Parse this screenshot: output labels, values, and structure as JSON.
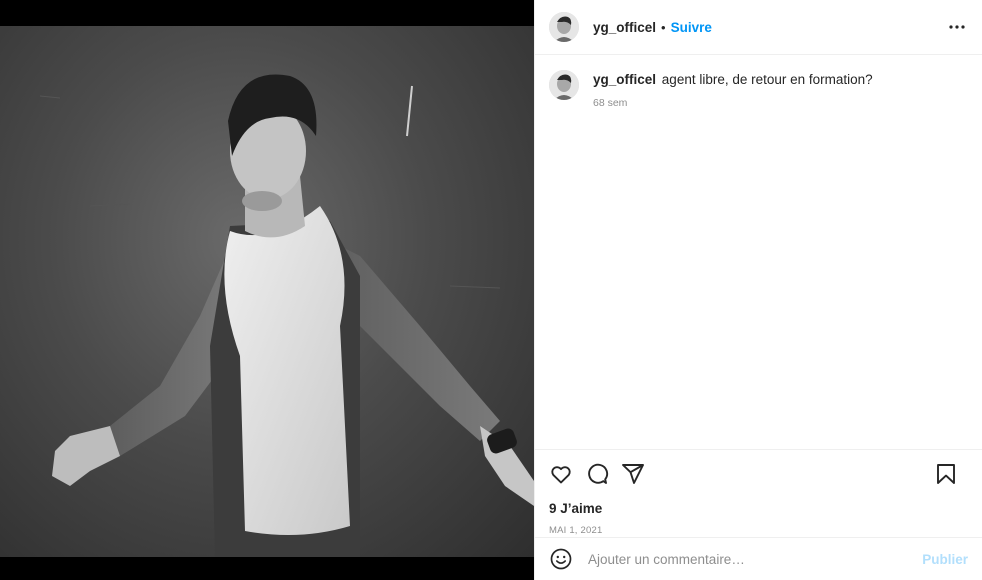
{
  "post": {
    "username": "yg_officel",
    "separator": "•",
    "follow_label": "Suivre",
    "more_icon": "more-horizontal-icon"
  },
  "caption": {
    "username": "yg_officel",
    "text": "agent libre, de retour en formation?",
    "time_ago": "68 sem"
  },
  "actions": {
    "icons": [
      "heart-icon",
      "comment-icon",
      "share-icon",
      "bookmark-icon"
    ],
    "likes": "9 J’aime",
    "date": "MAI 1, 2021"
  },
  "comment_box": {
    "placeholder": "Ajouter un commentaire…",
    "publish_label": "Publier",
    "emoji_icon": "emoji-icon"
  },
  "colors": {
    "accent": "#0095f6",
    "accent_disabled": "#b2dffc",
    "text_primary": "#262626",
    "text_secondary": "#8e8e8e",
    "divider": "#efefef"
  }
}
